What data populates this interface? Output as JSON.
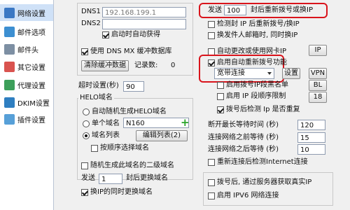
{
  "sidebar": {
    "items": [
      {
        "label": "网络设置",
        "color": "#3b78c4"
      },
      {
        "label": "邮件选项",
        "color": "#3d8fd1"
      },
      {
        "label": "邮件头",
        "color": "#7d8fa3"
      },
      {
        "label": "其它设置",
        "color": "#d9534f"
      },
      {
        "label": "代理设置",
        "color": "#3c9f5a"
      },
      {
        "label": "DKIM设置",
        "color": "#2f7fc1"
      },
      {
        "label": "插件设置",
        "color": "#57a0d8"
      }
    ]
  },
  "dns": {
    "dns1_label": "DNS1",
    "dns1_value": "192.168.199.1",
    "dns2_label": "DNS2",
    "dns2_value": "",
    "auto_get_label": "启动时自动获得",
    "mx_cache_label": "使用 DNS MX 缓冲数据库",
    "clear_cache_button": "清除缓冲数据",
    "record_count_label": "记录数:",
    "record_count_value": "0"
  },
  "timeout": {
    "label": "超时设置(秒)",
    "value": "90"
  },
  "helo": {
    "group_label": "HELO域名",
    "auto_random_label": "自动随机生成HELO域名",
    "single_domain_label": "单个域名",
    "single_domain_value": "N160",
    "domain_list_label": "域名列表",
    "edit_list_button": "编辑列表(2)",
    "order_select_label": "按顺序选择域名",
    "random_second_level_label": "随机生成此域名的二级域名",
    "send_label": "发送",
    "send_value": "1",
    "send_suffix": "封后更换域名",
    "sync_ip_label": "换IP的同时更换域名"
  },
  "redial": {
    "send_label": "发送",
    "send_value": "100",
    "send_suffix": "封后重新拨号或换IP",
    "detect_ip_label": "检测封 IP 后重新拨号/换IP",
    "switch_user_label": "换发件人邮箱时, 同时换IP",
    "auto_nic_label": "自动更改或使用网卡IP",
    "ip_button": "IP",
    "auto_redial_label": "启用自动重新拨号功能",
    "broadband_select": "宽带连接",
    "settings_button": "设置",
    "vpn_button": "VPN",
    "ip_blacklist_label": "启用拨号IP段黑名单",
    "bl_button": "BL",
    "ip_order_label": "启用 IP 段顺序限制",
    "eighteen_button": "18",
    "detect_repeat_label": "拨号后检测 Ip 是否重复"
  },
  "timings": {
    "disconnect_label": "断开最长等待时间 (秒)",
    "disconnect_value": "120",
    "connect_before_label": "连接网络之前等待 (秒)",
    "connect_before_value": "15",
    "connect_after_label": "连接网络之后等待 (秒)",
    "connect_after_value": "10",
    "recheck_label": "重新连接后检测Internet连接"
  },
  "footer": {
    "server_ip_label": "拨号后, 通过服务器获取真实IP",
    "ipv6_label": "启用 IPV6 网络连接"
  },
  "colors": {
    "highlight_red": "#d9141c",
    "selected_row": "#cfe1f7",
    "green_plus": "#2aa52a"
  }
}
